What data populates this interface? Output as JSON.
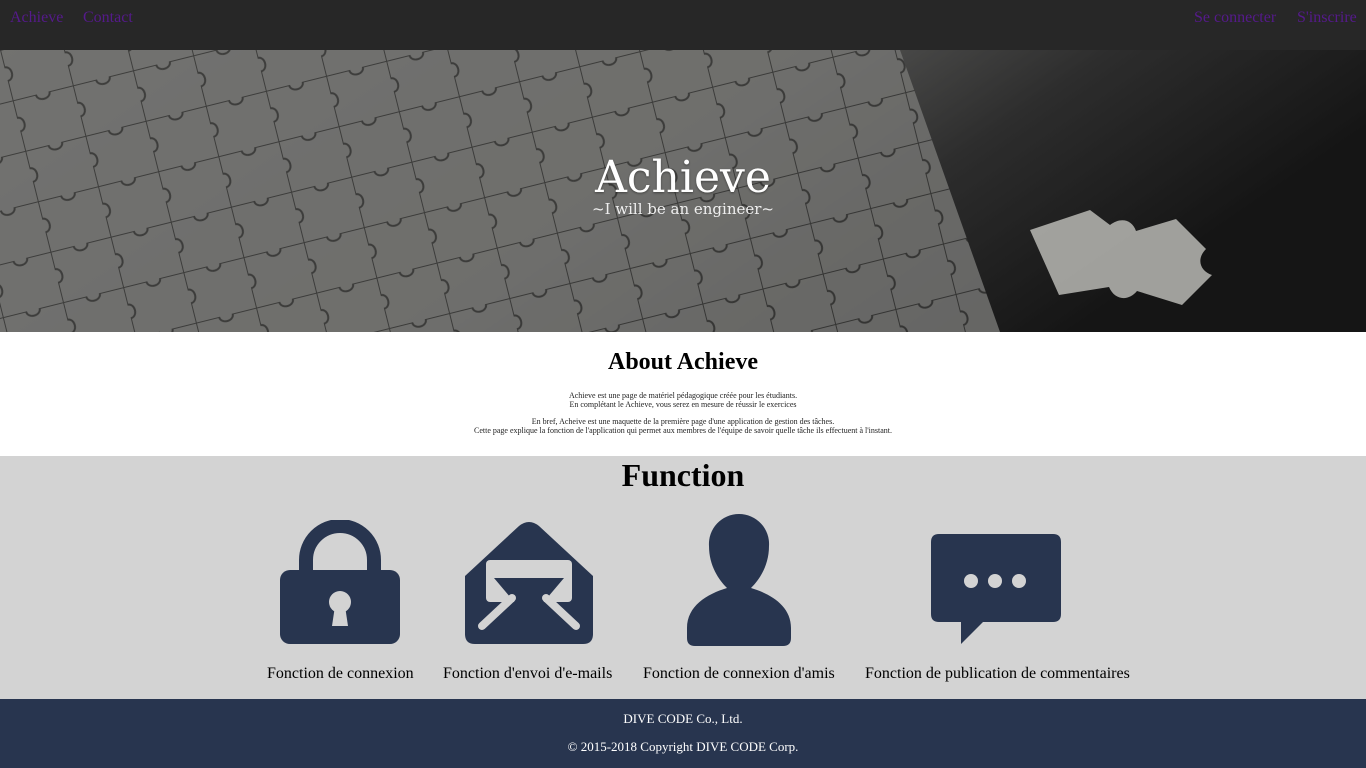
{
  "nav": {
    "brand": "Achieve",
    "contact": "Contact",
    "login": "Se connecter",
    "signup": "S'inscrire"
  },
  "hero": {
    "title": "Achieve",
    "subtitle": "~I will be an engineer~"
  },
  "about": {
    "title": "About Achieve",
    "line1": "Achieve est une page de matériel pédagogique créée pour les étudiants.",
    "line2": "En complétant le Achieve, vous serez en mesure de réussir le exercices",
    "line3": "En bref, Acheive est une maquette de la première page d'une application de gestion des tâches.",
    "line4": "Cette page explique la fonction de l'application qui permet aux membres de l'équipe de savoir quelle tâche ils effectuent à l'instant."
  },
  "function": {
    "title": "Function",
    "items": [
      {
        "label": "Fonction de connexion",
        "icon": "lock-icon"
      },
      {
        "label": "Fonction d'envoi d'e-mails",
        "icon": "envelope-icon"
      },
      {
        "label": "Fonction de connexion d'amis",
        "icon": "user-icon"
      },
      {
        "label": "Fonction de publication de commentaires",
        "icon": "chat-bubble-icon"
      }
    ],
    "icon_color": "#28354f"
  },
  "footer": {
    "company": "DIVE  CODE Co., Ltd.",
    "copyright": "© 2015-2018 Copyright DIVE  CODE Corp."
  }
}
